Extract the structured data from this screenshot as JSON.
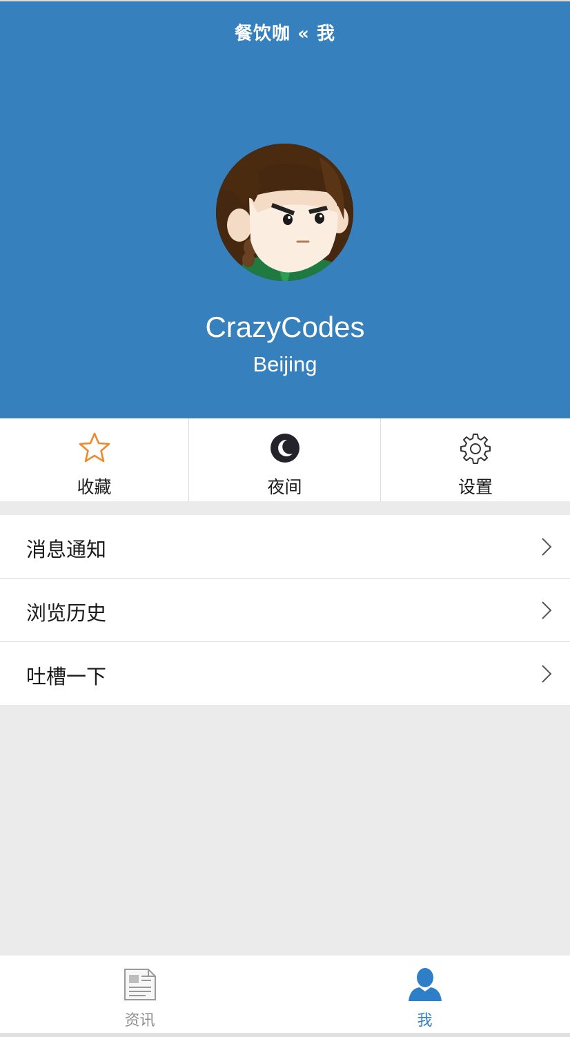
{
  "colors": {
    "header_bg": "#3680bd",
    "page_bg": "#ebebeb",
    "star_accent": "#ec8a2d",
    "tab_active": "#2f7fc8",
    "tab_inactive": "#8e8e8e"
  },
  "nav": {
    "title": "餐饮咖 « 我"
  },
  "profile": {
    "avatar_icon": "cartoon-avatar-icon",
    "username": "CrazyCodes",
    "city": "Beijing"
  },
  "quick_actions": [
    {
      "label": "收藏",
      "icon": "star-icon"
    },
    {
      "label": "夜间",
      "icon": "moon-icon"
    },
    {
      "label": "设置",
      "icon": "gear-icon"
    }
  ],
  "menu": [
    {
      "label": "消息通知",
      "icon": "chevron-right-icon"
    },
    {
      "label": "浏览历史",
      "icon": "chevron-right-icon"
    },
    {
      "label": "吐槽一下",
      "icon": "chevron-right-icon"
    }
  ],
  "tabs": [
    {
      "label": "资讯",
      "icon": "newspaper-icon",
      "active": false
    },
    {
      "label": "我",
      "icon": "user-icon",
      "active": true
    }
  ]
}
